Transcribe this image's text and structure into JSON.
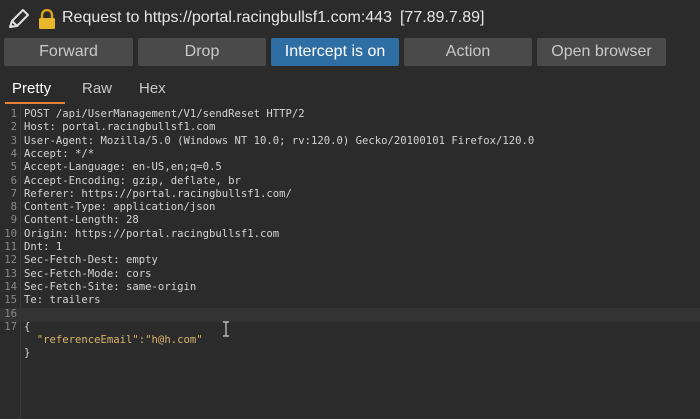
{
  "title": {
    "request_label": "Request to https://portal.racingbullsf1.com:443",
    "ip": "[77.89.7.89]",
    "icons": [
      "pencil-icon",
      "lock-icon"
    ]
  },
  "buttons": {
    "forward": "Forward",
    "drop": "Drop",
    "intercept": "Intercept is on",
    "action": "Action",
    "open_browser": "Open browser"
  },
  "tabs": [
    "Pretty",
    "Raw",
    "Hex"
  ],
  "active_tab": "Pretty",
  "colors": {
    "accent": "#2f6ea3",
    "tab_underline": "#e8833a"
  },
  "editor": {
    "lines": [
      {
        "n": "1",
        "text": "POST /api/UserManagement/V1/sendReset HTTP/2"
      },
      {
        "n": "2",
        "text": "Host: portal.racingbullsf1.com"
      },
      {
        "n": "3",
        "text": "User-Agent: Mozilla/5.0 (Windows NT 10.0; rv:120.0) Gecko/20100101 Firefox/120.0"
      },
      {
        "n": "4",
        "text": "Accept: */*"
      },
      {
        "n": "5",
        "text": "Accept-Language: en-US,en;q=0.5"
      },
      {
        "n": "6",
        "text": "Accept-Encoding: gzip, deflate, br"
      },
      {
        "n": "7",
        "text": "Referer: https://portal.racingbullsf1.com/"
      },
      {
        "n": "8",
        "text": "Content-Type: application/json"
      },
      {
        "n": "9",
        "text": "Content-Length: 28"
      },
      {
        "n": "10",
        "text": "Origin: https://portal.racingbullsf1.com"
      },
      {
        "n": "11",
        "text": "Dnt: 1"
      },
      {
        "n": "12",
        "text": "Sec-Fetch-Dest: empty"
      },
      {
        "n": "13",
        "text": "Sec-Fetch-Mode: cors"
      },
      {
        "n": "14",
        "text": "Sec-Fetch-Site: same-origin"
      },
      {
        "n": "15",
        "text": "Te: trailers"
      },
      {
        "n": "16",
        "text": ""
      },
      {
        "n": "17",
        "text": "{"
      },
      {
        "n": "",
        "text": "  \"referenceEmail\":\"h@h.com\""
      },
      {
        "n": "",
        "text": "}"
      }
    ]
  }
}
